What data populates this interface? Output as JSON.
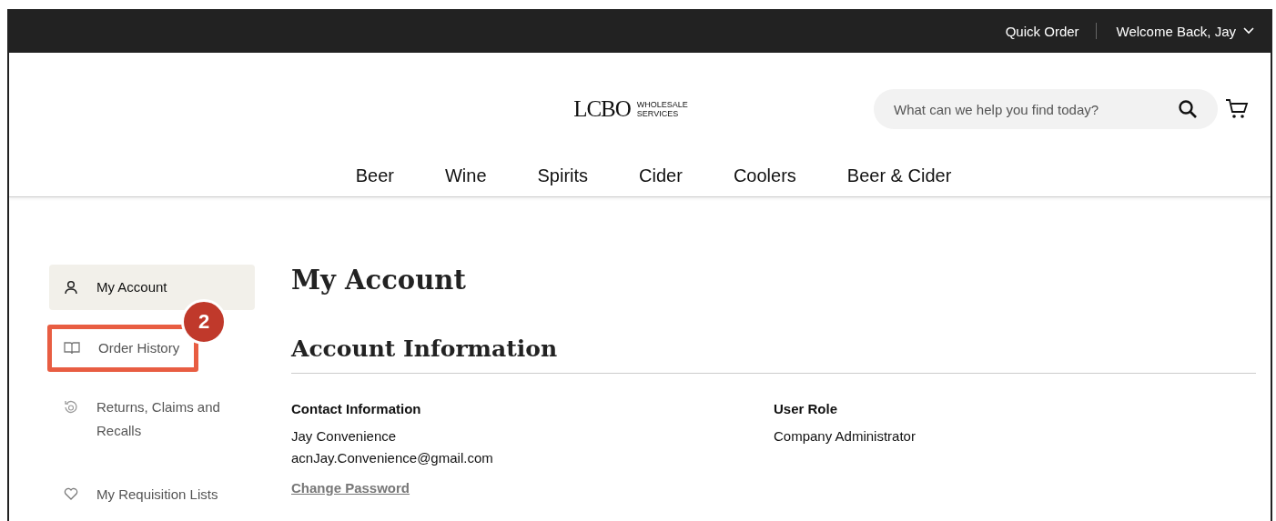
{
  "top_bar": {
    "links": [
      "Quick Order",
      "Welcome Back, Jay"
    ]
  },
  "logo": {
    "mark": "LCBO",
    "sub": [
      "WHOLESALE",
      "SERVICES"
    ]
  },
  "search": {
    "placeholder": "What can we help you find today?"
  },
  "nav": [
    "Beer",
    "Wine",
    "Spirits",
    "Cider",
    "Coolers",
    "Beer & Cider"
  ],
  "sidebar": {
    "items": [
      {
        "label": "My Account",
        "kind": "person",
        "selected": true,
        "highlighted": false
      },
      {
        "label": "Order History",
        "kind": "book",
        "selected": false,
        "highlighted": true
      },
      {
        "label": "Returns, Claims and Recalls",
        "kind": "returns",
        "selected": false,
        "highlighted": false
      },
      {
        "label": "My Requisition Lists",
        "kind": "heart",
        "selected": false,
        "highlighted": false
      }
    ]
  },
  "annotation": {
    "number": "2"
  },
  "main": {
    "title": "My Account",
    "section": "Account Information",
    "columns": [
      {
        "heading": "Contact Information",
        "lines": [
          "Jay Convenience",
          "acnJay.Convenience@gmail.com"
        ],
        "link": "Change Password"
      },
      {
        "heading": "User Role",
        "lines": [
          "Company Administrator"
        ]
      }
    ]
  }
}
